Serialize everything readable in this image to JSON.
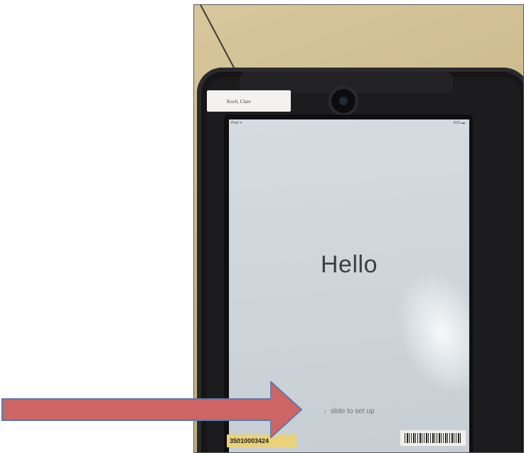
{
  "photo": {
    "device": {
      "name_label": "Koch, Clare",
      "status_bar": {
        "left": "iPad ᯤ",
        "right": "61% ▬"
      },
      "greeting": "Hello",
      "slide_prompt": {
        "chevron": "›",
        "text": "slide to set up"
      },
      "asset_tag": "35010003424"
    }
  },
  "annotation": {
    "arrow_icon": "arrow-right-icon",
    "color": "#cc6564",
    "outline": "#5b7aa8"
  }
}
